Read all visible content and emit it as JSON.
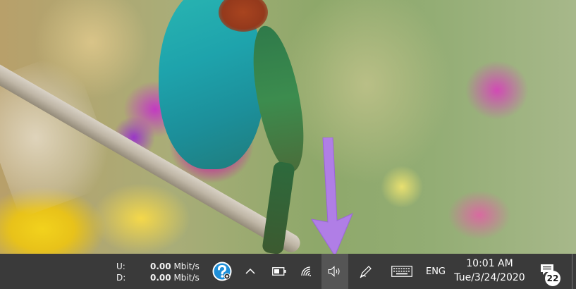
{
  "taskbar": {
    "network_meter": {
      "upload_label": "U:",
      "download_label": "D:",
      "upload_value": "0.00",
      "upload_unit": "Mbit/s",
      "download_value": "0.00",
      "download_unit": "Mbit/s"
    },
    "tray_icons": [
      "help-icon",
      "chevron-up-icon",
      "battery-icon",
      "wifi-icon",
      "volume-icon",
      "pen-icon",
      "keyboard-icon"
    ],
    "language": "ENG",
    "clock": {
      "time": "10:01 AM",
      "date": "Tue/3/24/2020"
    },
    "notifications": {
      "count": "22"
    }
  },
  "colors": {
    "taskbar_bg": "#3a3a3a",
    "volume_highlight": "#555555",
    "arrow": "#b07ee6",
    "help_icon": "#1e8fd8"
  }
}
